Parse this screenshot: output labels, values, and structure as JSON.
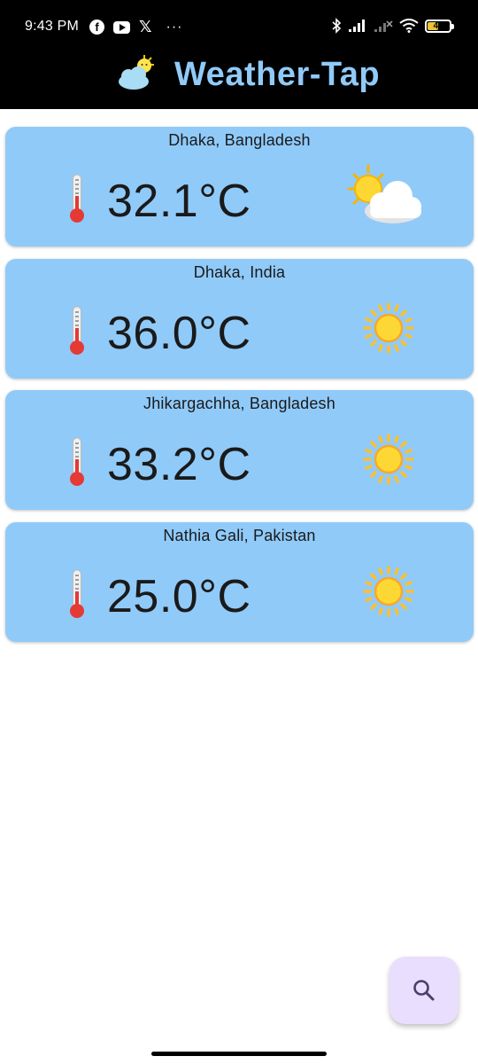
{
  "status_bar": {
    "time": "9:43 PM",
    "more": "···",
    "battery_level": "47"
  },
  "app": {
    "title": "Weather-Tap",
    "accent_color": "#90caf9"
  },
  "cards": [
    {
      "location": "Dhaka, Bangladesh",
      "temperature": "32.1°C",
      "condition_icon": "sun-behind-cloud-icon"
    },
    {
      "location": "Dhaka, India",
      "temperature": "36.0°C",
      "condition_icon": "sun-icon"
    },
    {
      "location": "Jhikargachha, Bangladesh",
      "temperature": "33.2°C",
      "condition_icon": "sun-icon"
    },
    {
      "location": "Nathia Gali, Pakistan",
      "temperature": "25.0°C",
      "condition_icon": "sun-icon"
    }
  ],
  "fab": {
    "icon": "search-icon",
    "color": "#e9defe"
  }
}
